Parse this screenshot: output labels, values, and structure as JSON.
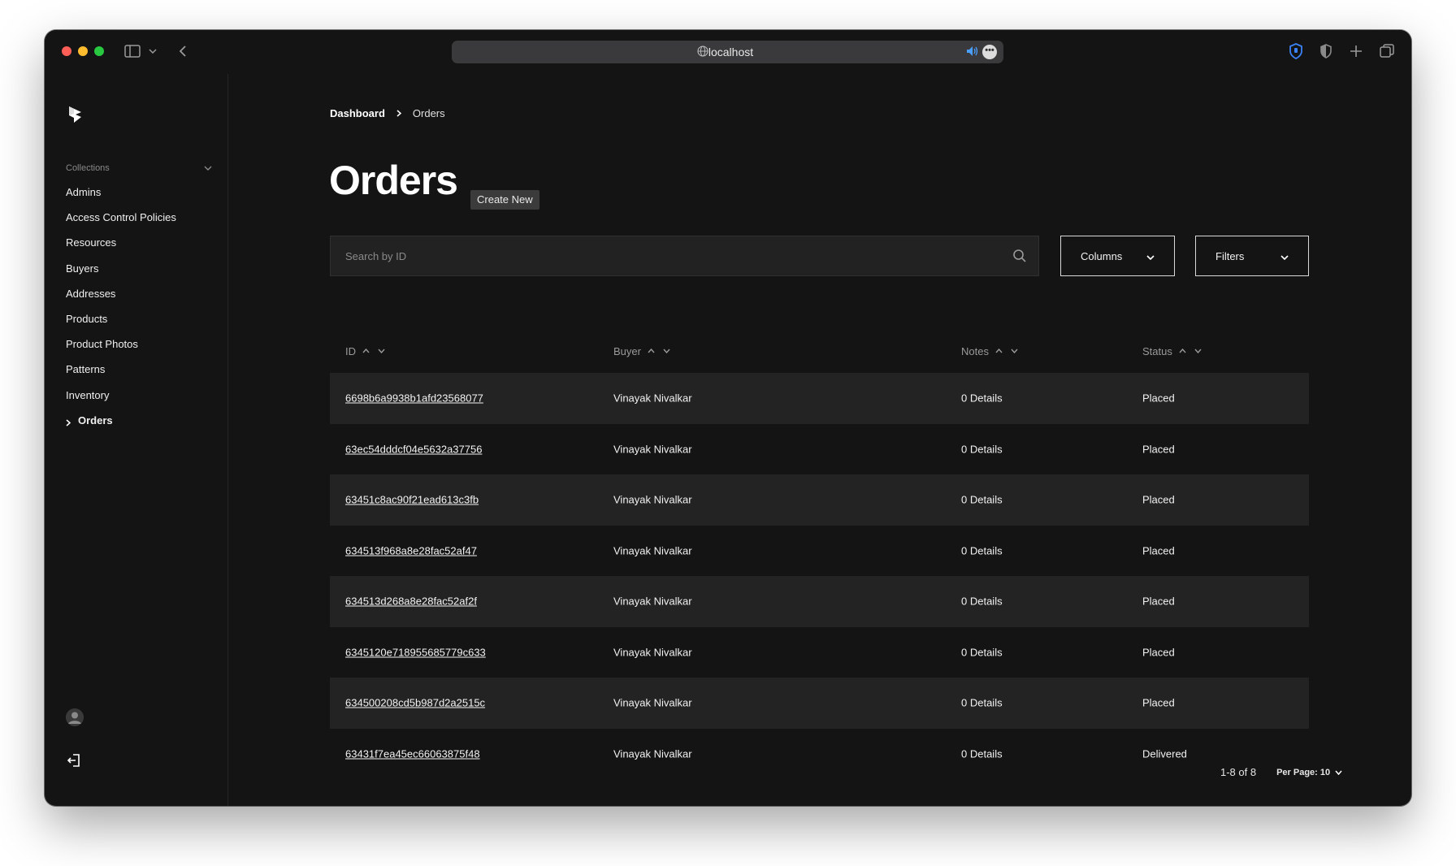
{
  "browser": {
    "url": "localhost"
  },
  "sidebar": {
    "section_label": "Collections",
    "items": [
      {
        "label": "Admins"
      },
      {
        "label": "Access Control Policies"
      },
      {
        "label": "Resources"
      },
      {
        "label": "Buyers"
      },
      {
        "label": "Addresses"
      },
      {
        "label": "Products"
      },
      {
        "label": "Product Photos"
      },
      {
        "label": "Patterns"
      },
      {
        "label": "Inventory"
      },
      {
        "label": "Orders",
        "active": true
      }
    ]
  },
  "breadcrumb": {
    "home": "Dashboard",
    "current": "Orders"
  },
  "page": {
    "title": "Orders",
    "create_label": "Create New",
    "search_placeholder": "Search by ID",
    "columns_label": "Columns",
    "filters_label": "Filters"
  },
  "table": {
    "headers": [
      "ID",
      "Buyer",
      "Notes",
      "Status"
    ],
    "rows": [
      {
        "id": "6698b6a9938b1afd23568077",
        "buyer": "Vinayak Nivalkar",
        "notes": "0 Details",
        "status": "Placed"
      },
      {
        "id": "63ec54dddcf04e5632a37756",
        "buyer": "Vinayak Nivalkar",
        "notes": "0 Details",
        "status": "Placed"
      },
      {
        "id": "63451c8ac90f21ead613c3fb",
        "buyer": "Vinayak Nivalkar",
        "notes": "0 Details",
        "status": "Placed"
      },
      {
        "id": "634513f968a8e28fac52af47",
        "buyer": "Vinayak Nivalkar",
        "notes": "0 Details",
        "status": "Placed"
      },
      {
        "id": "634513d268a8e28fac52af2f",
        "buyer": "Vinayak Nivalkar",
        "notes": "0 Details",
        "status": "Placed"
      },
      {
        "id": "6345120e718955685779c633",
        "buyer": "Vinayak Nivalkar",
        "notes": "0 Details",
        "status": "Placed"
      },
      {
        "id": "634500208cd5b987d2a2515c",
        "buyer": "Vinayak Nivalkar",
        "notes": "0 Details",
        "status": "Placed"
      },
      {
        "id": "63431f7ea45ec66063875f48",
        "buyer": "Vinayak Nivalkar",
        "notes": "0 Details",
        "status": "Delivered"
      }
    ]
  },
  "pagination": {
    "range": "1-8 of 8",
    "per_page": "Per Page: 10"
  },
  "colors": {
    "background": "#141414",
    "row_alt": "#232323",
    "accent_shield": "#3b82f6"
  }
}
